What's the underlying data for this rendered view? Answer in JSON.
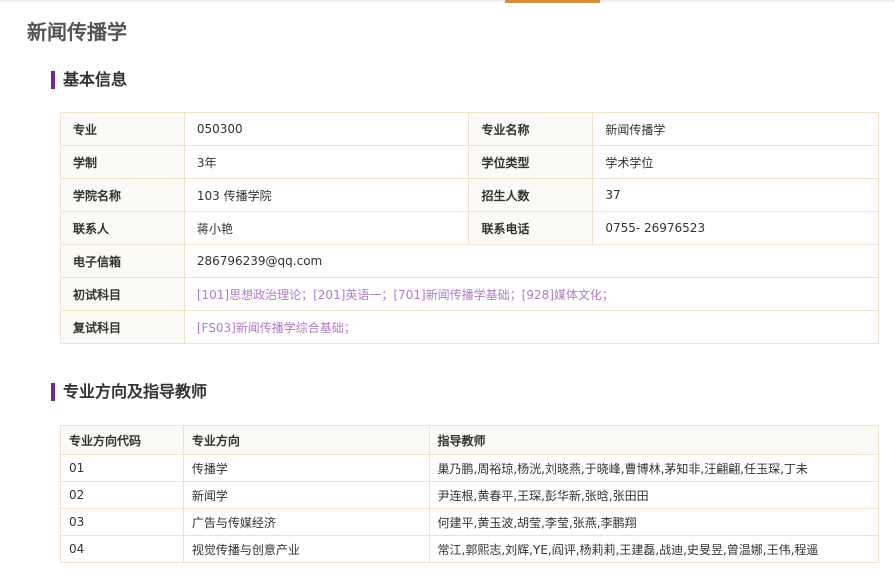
{
  "page_title": "新闻传播学",
  "basic_info": {
    "section_title": "基本信息",
    "major_code_label": "专业",
    "major_code_value": "050300",
    "major_name_label": "专业名称",
    "major_name_value": "新闻传播学",
    "duration_label": "学制",
    "duration_value": "3年",
    "degree_type_label": "学位类型",
    "degree_type_value": "学术学位",
    "college_label": "学院名称",
    "college_value": "103 传播学院",
    "enrollment_label": "招生人数",
    "enrollment_value": "37",
    "contact_label": "联系人",
    "contact_value": "蒋小艳",
    "phone_label": "联系电话",
    "phone_value": "0755- 26976523",
    "email_label": "电子信箱",
    "email_value": "286796239@qq.com",
    "initial_exam_label": "初试科目",
    "initial_exam_value": "[101]思想政治理论；[201]英语一；[701]新闻传播学基础；[928]媒体文化；",
    "retest_label": "复试科目",
    "retest_value": "[FS03]新闻传播学综合基础；"
  },
  "directions": {
    "section_title": "专业方向及指导教师",
    "headers": {
      "code": "专业方向代码",
      "direction": "专业方向",
      "advisors": "指导教师"
    },
    "rows": [
      {
        "code": "01",
        "direction": "传播学",
        "advisors": "巢乃鹏,周裕琼,杨洸,刘晓燕,于晓峰,曹博林,茅知非,汪翩翩,任玉琛,丁未"
      },
      {
        "code": "02",
        "direction": "新闻学",
        "advisors": "尹连根,黄春平,王琛,彭华新,张晗,张田田"
      },
      {
        "code": "03",
        "direction": "广告与传媒经济",
        "advisors": "何建平,黄玉波,胡莹,李莹,张燕,李鹏翔"
      },
      {
        "code": "04",
        "direction": "视觉传播与创意产业",
        "advisors": "常江,郭熙志,刘辉,YE,阎评,杨莉莉,王建磊,战迪,史旻昱,曾温娜,王伟,程遥"
      }
    ]
  }
}
